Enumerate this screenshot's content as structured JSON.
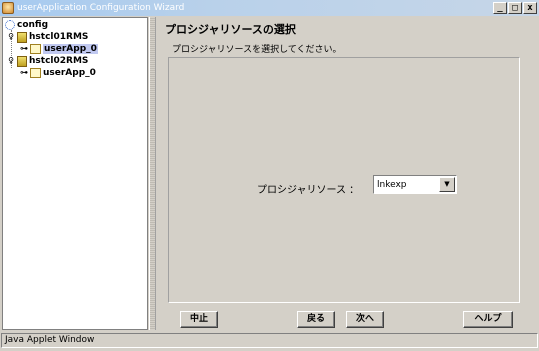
{
  "window": {
    "title": "userApplication Configuration Wizard",
    "controls": {
      "minimize": "_",
      "maximize": "□",
      "close": "x"
    }
  },
  "tree": {
    "root": {
      "label": "config",
      "icon": "config-icon"
    },
    "nodes": [
      {
        "label": "hstcl01RMS",
        "icon": "host-icon",
        "child": {
          "label": "userApp_0",
          "icon": "app-icon",
          "selected": true
        }
      },
      {
        "label": "hstcl02RMS",
        "icon": "host-icon",
        "child": {
          "label": "userApp_0",
          "icon": "app-icon",
          "selected": false
        }
      }
    ],
    "expander_open": "♀",
    "expander_leaf": "⊶"
  },
  "main": {
    "title": "プロシジャリソースの選択",
    "subtitle": "プロシジャリソースを選択してください。",
    "resource_label": "プロシジャリソース ：",
    "resource_value": "lnkexp"
  },
  "buttons": {
    "cancel": "中止",
    "back": "戻る",
    "next": "次へ",
    "help": "ヘルプ"
  },
  "status": {
    "text": "Java Applet Window"
  },
  "colors": {
    "window_bg": "#d4d0c8",
    "titlebar": "#a6caf0",
    "selection": "#c0c8f0"
  }
}
